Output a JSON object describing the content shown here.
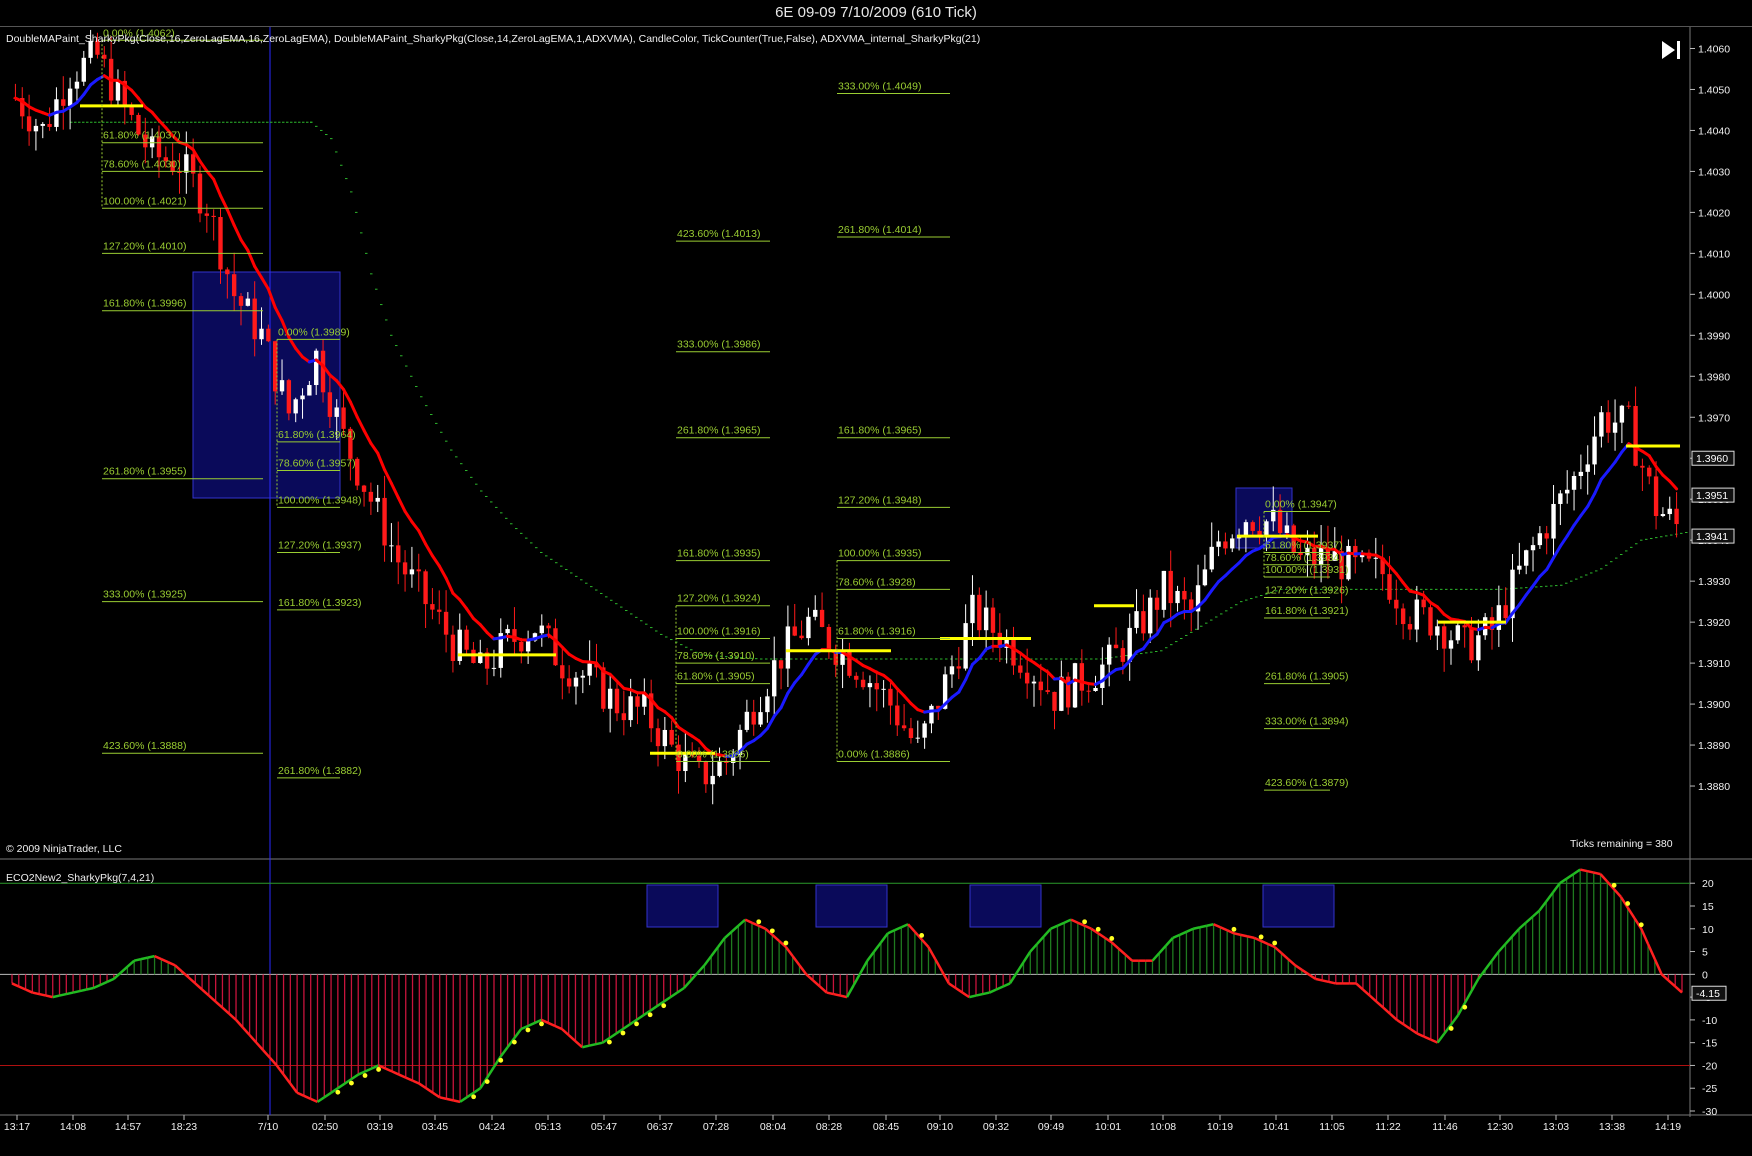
{
  "window": {
    "title": "6E 09-09  7/10/2009 (610 Tick)"
  },
  "colors": {
    "background": "#000000",
    "upCandle": "#ffffff",
    "downCandle": "#ff1a1a",
    "maRed": "#ff0000",
    "maBlue": "#1a1aff",
    "yellowLevel": "#ffff00",
    "fibLine": "#9acd32",
    "fibText": "#9acd32",
    "adxvma": "#2db82d",
    "boxFill": "#0a0a5a",
    "histPos": "#1f7a1f",
    "histNeg": "#c8143c",
    "dots": "#ffff22"
  },
  "chart_data": [
    {
      "type": "candlestick",
      "panel": "price",
      "indicator_label": "DoubleMAPaint_SharkyPkg(Close,16,ZeroLagEMA,16,ZeroLagEMA),  DoubleMAPaint_SharkyPkg(Close,14,ZeroLagEMA,1,ADXVMA),  CandleColor,  TickCounter(True,False),  ADXVMA_internal_SharkyPkg(21)",
      "copyright": "© 2009 NinjaTrader, LLC",
      "ticks_remaining": "Ticks remaining = 380",
      "ylim": [
        1.387,
        1.4065
      ],
      "y_ticks": [
        "1.4060",
        "1.4050",
        "1.4040",
        "1.4030",
        "1.4020",
        "1.4010",
        "1.4000",
        "1.3990",
        "1.3980",
        "1.3970",
        "1.3960",
        "1.3950",
        "1.3940",
        "1.3930",
        "1.3920",
        "1.3910",
        "1.3900",
        "1.3890",
        "1.3880"
      ],
      "price_markers": [
        "1.3960",
        "1.3951",
        "1.3941"
      ],
      "x_ticks": [
        "13:17",
        "14:08",
        "14:57",
        "18:23",
        "7/10",
        "02:50",
        "03:19",
        "03:45",
        "04:24",
        "05:13",
        "05:47",
        "06:37",
        "07:28",
        "08:04",
        "08:28",
        "08:45",
        "09:10",
        "09:32",
        "09:49",
        "10:01",
        "10:08",
        "10:19",
        "10:41",
        "11:05",
        "11:22",
        "11:46",
        "12:30",
        "13:03",
        "13:38",
        "14:19"
      ],
      "price_path": [
        1.4048,
        1.404,
        1.4054,
        1.4058,
        1.4045,
        1.4034,
        1.4032,
        1.4022,
        1.4,
        1.399,
        1.3971,
        1.3985,
        1.3965,
        1.395,
        1.3935,
        1.3925,
        1.3915,
        1.3908,
        1.3915,
        1.3919,
        1.391,
        1.3906,
        1.39,
        1.3898,
        1.3889,
        1.3882,
        1.3886,
        1.39,
        1.3912,
        1.392,
        1.3914,
        1.3908,
        1.39,
        1.3889,
        1.3905,
        1.3922,
        1.3917,
        1.391,
        1.3902,
        1.3906,
        1.391,
        1.3918,
        1.3928,
        1.3922,
        1.394,
        1.3946,
        1.3944,
        1.3935,
        1.3936,
        1.3933,
        1.3932,
        1.3922,
        1.392,
        1.3914,
        1.3918,
        1.3932,
        1.3944,
        1.3955,
        1.397,
        1.3968,
        1.3948,
        1.3942
      ],
      "fib_labels": [
        {
          "text": "0.00% (1.4062)"
        },
        {
          "text": "61.80% (1.4037)"
        },
        {
          "text": "78.60% (1.4030)"
        },
        {
          "text": "100.00% (1.4021)"
        },
        {
          "text": "127.20% (1.4010)"
        },
        {
          "text": "161.80% (1.3996)"
        },
        {
          "text": "261.80% (1.3955)"
        },
        {
          "text": "333.00% (1.3925)"
        },
        {
          "text": "423.60% (1.3888)"
        },
        {
          "text": "0.00% (1.3989)"
        },
        {
          "text": "61.80% (1.3964)"
        },
        {
          "text": "78.60% (1.3957)"
        },
        {
          "text": "100.00% (1.3948)"
        },
        {
          "text": "127.20% (1.3937)"
        },
        {
          "text": "161.80% (1.3923)"
        },
        {
          "text": "261.80% (1.3882)"
        },
        {
          "text": "423.60% (1.4013)"
        },
        {
          "text": "333.00% (1.3986)"
        },
        {
          "text": "261.80% (1.3965)"
        },
        {
          "text": "161.80% (1.3935)"
        },
        {
          "text": "127.20% (1.3924)"
        },
        {
          "text": "100.00% (1.3916)"
        },
        {
          "text": "78.60% (1.3910)"
        },
        {
          "text": "61.80% (1.3905)"
        },
        {
          "text": "0.00% (1.3886)"
        },
        {
          "text": "333.00% (1.4049)"
        },
        {
          "text": "261.80% (1.4014)"
        },
        {
          "text": "161.80% (1.3965)"
        },
        {
          "text": "127.20% (1.3948)"
        },
        {
          "text": "100.00% (1.3935)"
        },
        {
          "text": "78.60% (1.3928)"
        },
        {
          "text": "61.80% (1.3916)"
        },
        {
          "text": "0.00% (1.3886)"
        },
        {
          "text": "0.00% (1.3947)"
        },
        {
          "text": "61.80% (1.3937)"
        },
        {
          "text": "78.60% (1.3934)"
        },
        {
          "text": "100.00% (1.3931)"
        },
        {
          "text": "127.20% (1.3926)"
        },
        {
          "text": "161.80% (1.3921)"
        },
        {
          "text": "261.80% (1.3905)"
        },
        {
          "text": "333.00% (1.3894)"
        },
        {
          "text": "423.60% (1.3879)"
        }
      ]
    },
    {
      "type": "histogram",
      "panel": "oscillator",
      "indicator_label": "ECO2New2_SharkyPkg(7,4,21)",
      "ylim": [
        -30,
        24
      ],
      "y_ticks": [
        "20",
        "15",
        "10",
        "5",
        "0",
        "-5",
        "-10",
        "-15",
        "-20",
        "-25",
        "-30"
      ],
      "reference_lines": [
        20,
        -20
      ],
      "last_value": "-4.15",
      "values": [
        -2,
        -4,
        -5,
        -4,
        -3,
        -1,
        3,
        4,
        2,
        -2,
        -6,
        -10,
        -15,
        -20,
        -26,
        -28,
        -25,
        -22,
        -20,
        -22,
        -24,
        -27,
        -28,
        -25,
        -18,
        -12,
        -10,
        -12,
        -16,
        -15,
        -12,
        -9,
        -6,
        -3,
        2,
        8,
        12,
        10,
        6,
        0,
        -4,
        -5,
        3,
        9,
        11,
        6,
        -2,
        -5,
        -4,
        -2,
        5,
        10,
        12,
        10,
        7,
        3,
        3,
        8,
        10,
        11,
        9,
        8,
        6,
        2,
        -1,
        -2,
        -2,
        -6,
        -10,
        -13,
        -15,
        -9,
        -1,
        5,
        10,
        14,
        20,
        23,
        22,
        17,
        10,
        0,
        -4
      ]
    }
  ]
}
